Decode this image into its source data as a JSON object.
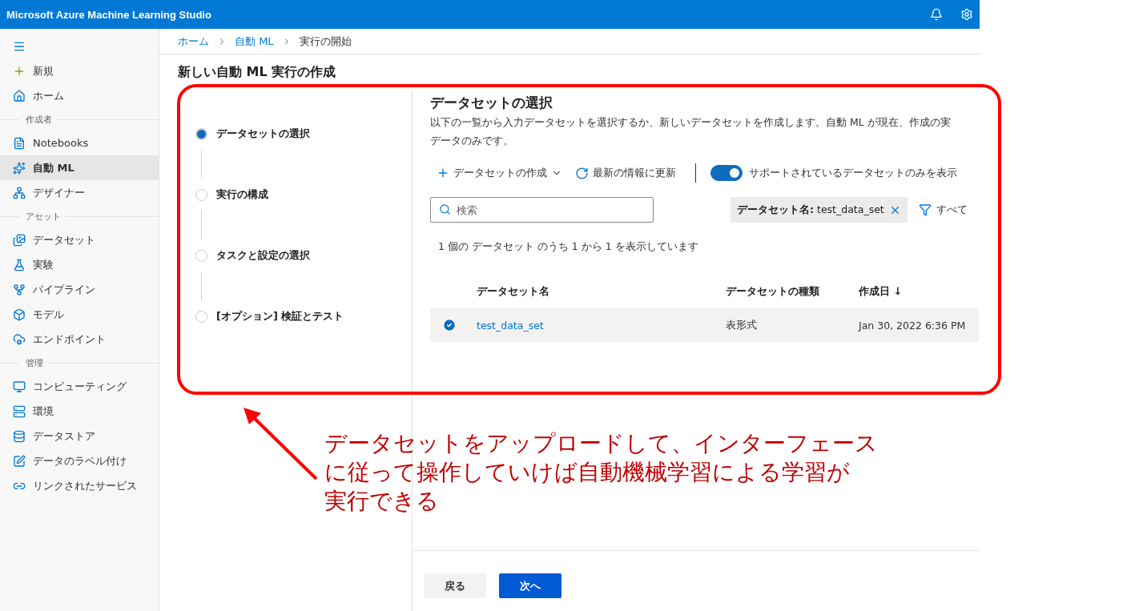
{
  "header": {
    "title": "Microsoft Azure Machine Learning Studio"
  },
  "sidebar": {
    "items": [
      {
        "kind": "new",
        "label": "新規",
        "selected": false
      },
      {
        "kind": "home",
        "label": "ホーム",
        "selected": false
      },
      {
        "kind": "section",
        "label": "作成者"
      },
      {
        "kind": "notebook",
        "label": "Notebooks",
        "selected": false
      },
      {
        "kind": "automl",
        "label": "自動 ML",
        "selected": true
      },
      {
        "kind": "designer",
        "label": "デザイナー",
        "selected": false
      },
      {
        "kind": "section",
        "label": "アセット"
      },
      {
        "kind": "dataset",
        "label": "データセット",
        "selected": false
      },
      {
        "kind": "experiment",
        "label": "実験",
        "selected": false
      },
      {
        "kind": "pipeline",
        "label": "パイプライン",
        "selected": false
      },
      {
        "kind": "model",
        "label": "モデル",
        "selected": false
      },
      {
        "kind": "endpoint",
        "label": "エンドポイント",
        "selected": false
      },
      {
        "kind": "section",
        "label": "管理"
      },
      {
        "kind": "compute",
        "label": "コンピューティング",
        "selected": false
      },
      {
        "kind": "environment",
        "label": "環境",
        "selected": false
      },
      {
        "kind": "datastore",
        "label": "データストア",
        "selected": false
      },
      {
        "kind": "labeling",
        "label": "データのラベル付け",
        "selected": false
      },
      {
        "kind": "linked",
        "label": "リンクされたサービス",
        "selected": false
      }
    ]
  },
  "breadcrumb": [
    {
      "label": "ホーム",
      "link": true
    },
    {
      "label": "自動 ML",
      "link": true
    },
    {
      "label": "実行の開始",
      "link": false
    }
  ],
  "page_title": "新しい自動 ML 実行の作成",
  "steps": [
    {
      "label": "データセットの選択",
      "selected": true
    },
    {
      "label": "実行の構成",
      "selected": false
    },
    {
      "label": "タスクと設定の選択",
      "selected": false
    },
    {
      "label": "[オプション] 検証とテスト",
      "selected": false
    }
  ],
  "panel": {
    "title": "データセットの選択",
    "description": [
      "以下の一覧から入力データセットを選択するか、新しいデータセットを作成します。自動 ML が現在、作成の実",
      "データのみです。"
    ],
    "toolbar": {
      "create": "データセットの作成",
      "refresh": "最新の情報に更新",
      "toggle_label": "サポートされているデータセットのみを表示",
      "toggle_on": true
    },
    "search": {
      "placeholder": "検索"
    },
    "filter_chip": {
      "key": "データセット名:",
      "value": "test_data_set"
    },
    "filter_button": "すべて",
    "count": "1 個の データセット のうち 1 から 1 を表示しています",
    "table": {
      "columns": [
        "データセット名",
        "データセットの種類",
        "作成日 ↓"
      ],
      "rows": [
        {
          "selected": true,
          "cells": [
            "test_data_set",
            "表形式",
            "Jan 30, 2022 6:36 PM"
          ]
        }
      ]
    }
  },
  "footer": {
    "back": "戻る",
    "next": "次へ"
  },
  "annotation": {
    "lines": [
      "データセットをアップロードして、インターフェース",
      "に従って操作していけば自動機械学習による学習が",
      "実行できる"
    ]
  }
}
